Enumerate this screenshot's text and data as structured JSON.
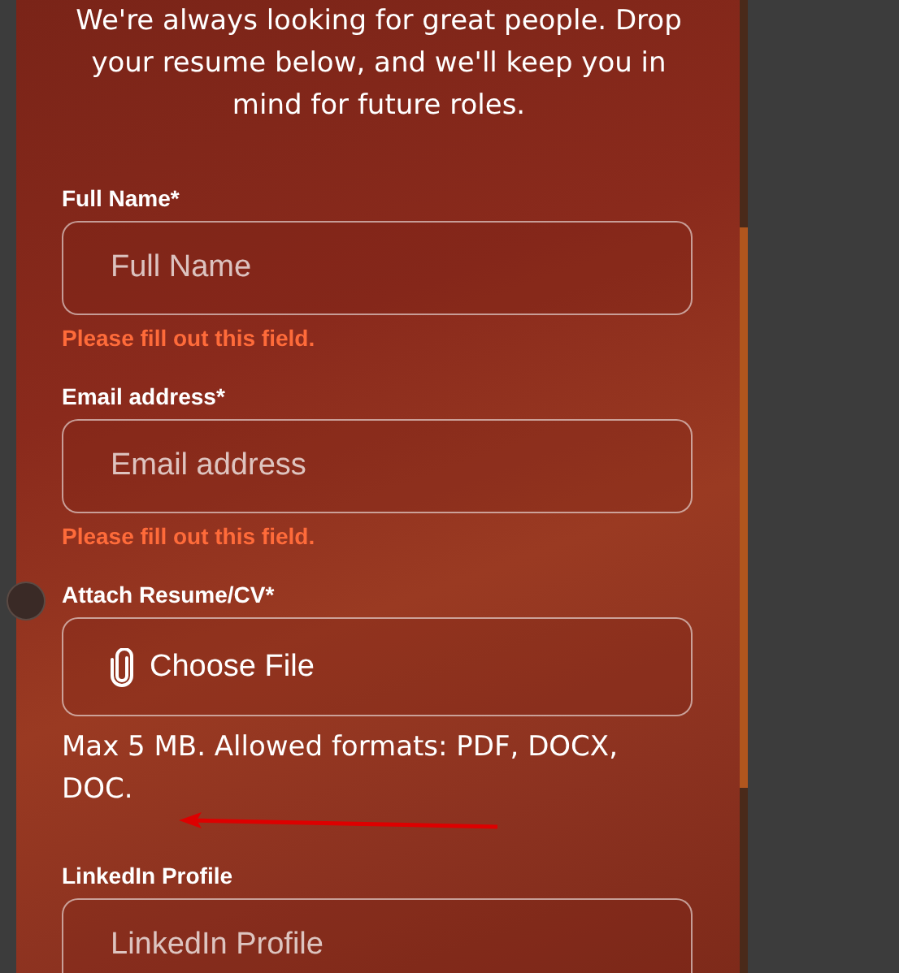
{
  "intro": "We're always looking for great people. Drop your resume below, and we'll keep you in mind for future roles.",
  "fields": [
    {
      "kind": "text",
      "label": "Full Name*",
      "placeholder": "Full Name",
      "error": "Please fill out this field."
    },
    {
      "kind": "text",
      "label": "Email address*",
      "placeholder": "Email address",
      "error": "Please fill out this field."
    },
    {
      "kind": "file",
      "label": "Attach Resume/CV*",
      "button": "Choose File",
      "hint": "Max 5 MB. Allowed formats: PDF, DOCX, DOC."
    },
    {
      "kind": "text",
      "label": "LinkedIn Profile",
      "placeholder": "LinkedIn Profile"
    }
  ]
}
